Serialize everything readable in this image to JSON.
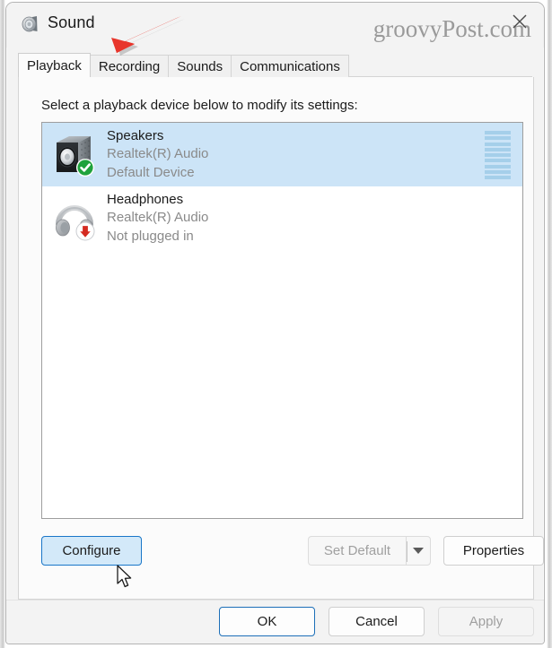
{
  "window": {
    "title": "Sound",
    "icon": "speaker-icon",
    "close_label": "×",
    "watermark": "groovyPost.com"
  },
  "tabs": [
    {
      "label": "Playback",
      "active": true
    },
    {
      "label": "Recording",
      "active": false
    },
    {
      "label": "Sounds",
      "active": false
    },
    {
      "label": "Communications",
      "active": false
    }
  ],
  "main": {
    "instruction": "Select a playback device below to modify its settings:"
  },
  "devices": [
    {
      "name": "Speakers",
      "driver": "Realtek(R) Audio",
      "status": "Default Device",
      "icon": "speaker-box-icon",
      "badge": "green-check-badge",
      "selected": true,
      "meter_segments": 9,
      "meter_active": 0
    },
    {
      "name": "Headphones",
      "driver": "Realtek(R) Audio",
      "status": "Not plugged in",
      "icon": "headphones-icon",
      "badge": "red-down-arrow-badge",
      "selected": false,
      "meter_segments": 0,
      "meter_active": 0
    }
  ],
  "device_buttons": {
    "configure": "Configure",
    "set_default": "Set Default",
    "set_default_arrow": "chevron-down-icon",
    "properties": "Properties"
  },
  "dialog_buttons": {
    "ok": "OK",
    "cancel": "Cancel",
    "apply": "Apply"
  },
  "annotation": {
    "type": "red-arrow",
    "points_to": "Playback",
    "color": "#E8352B"
  },
  "colors": {
    "selection": "#cce4f7",
    "accent": "#1976c8",
    "meter": "#9ecbe8",
    "badge_ok": "#1fa23c",
    "badge_warn": "#d42a20"
  }
}
